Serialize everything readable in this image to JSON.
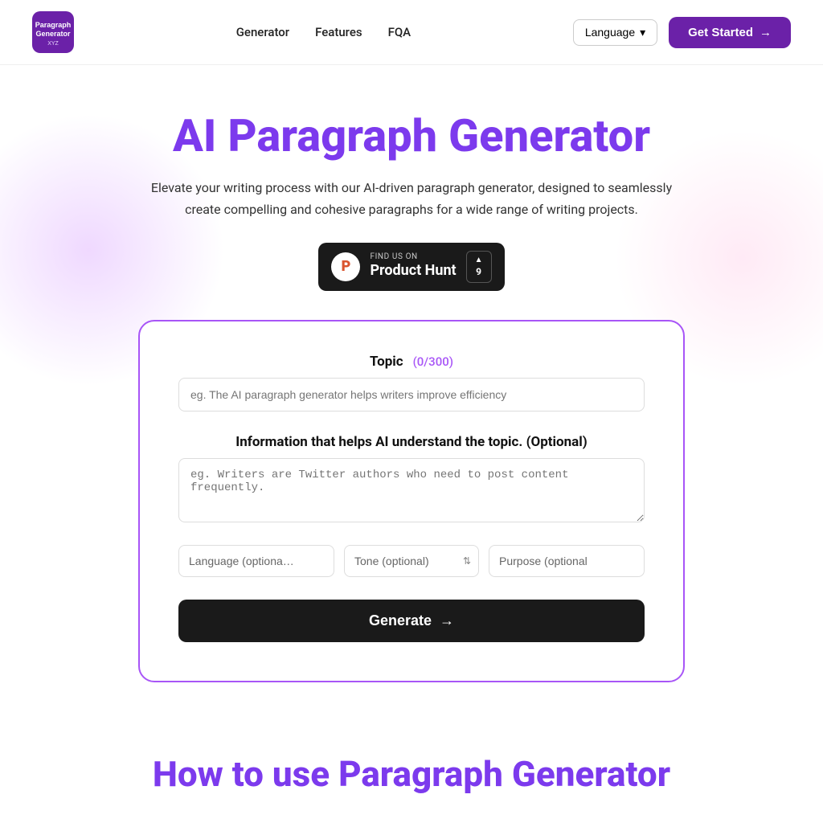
{
  "nav": {
    "logo_text": "Paragraph Generator XYZ",
    "links": [
      {
        "id": "generator",
        "label": "Generator"
      },
      {
        "id": "features",
        "label": "Features"
      },
      {
        "id": "fqa",
        "label": "FQA"
      }
    ],
    "language_btn": "Language",
    "cta_label": "Get Started",
    "cta_arrow": "→"
  },
  "hero": {
    "title": "AI Paragraph Generator",
    "subtitle": "Elevate your writing process with our AI-driven paragraph generator, designed to seamlessly create compelling and cohesive paragraphs for a wide range of writing projects."
  },
  "product_hunt": {
    "find_text": "FIND US ON",
    "name": "Product Hunt",
    "icon_letter": "P",
    "upvote_count": "9",
    "upvote_arrow": "▲"
  },
  "form": {
    "topic_label": "Topic",
    "topic_count": "(0/300)",
    "topic_placeholder": "eg. The AI paragraph generator helps writers improve efficiency",
    "info_label": "Information that helps AI understand the topic. (Optional)",
    "info_placeholder": "eg. Writers are Twitter authors who need to post content frequently.",
    "language_placeholder": "Language (optiona…",
    "tone_placeholder": "Tone (optional)",
    "purpose_placeholder": "Purpose (optional",
    "generate_label": "Generate",
    "generate_arrow": "→"
  },
  "how_to": {
    "title": "How to use Paragraph Generator"
  }
}
